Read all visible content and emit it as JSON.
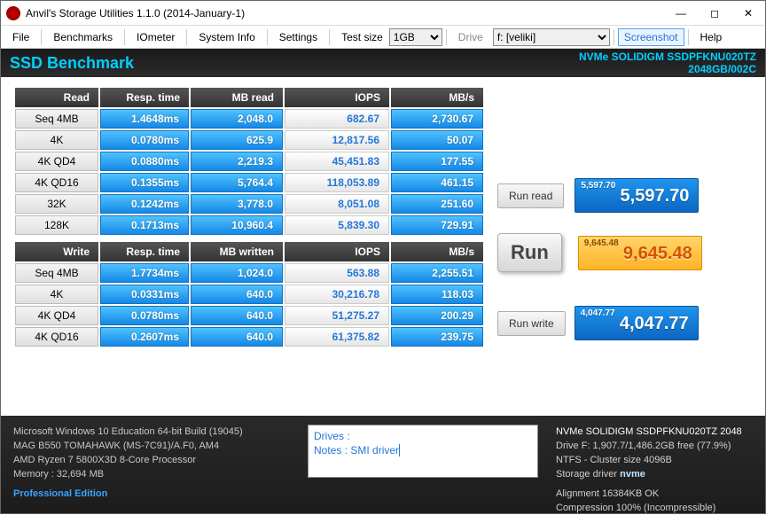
{
  "window": {
    "title": "Anvil's Storage Utilities 1.1.0 (2014-January-1)",
    "icon_letter": ""
  },
  "menu": {
    "file": "File",
    "benchmarks": "Benchmarks",
    "iometer": "IOmeter",
    "sysinfo": "System Info",
    "settings": "Settings",
    "test_size_label": "Test size",
    "test_size_selected": "1GB",
    "drive_label": "Drive",
    "drive_selected": "f: [veliki]",
    "screenshot": "Screenshot",
    "help": "Help"
  },
  "header": {
    "title": "SSD Benchmark",
    "device": "NVMe SOLIDIGM SSDPFKNU020TZ",
    "capacity": "2048GB/002C"
  },
  "read": {
    "headers": [
      "Read",
      "Resp. time",
      "MB read",
      "IOPS",
      "MB/s"
    ],
    "rows": [
      {
        "label": "Seq 4MB",
        "resp": "1.4648ms",
        "mb": "2,048.0",
        "iops": "682.67",
        "mbs": "2,730.67"
      },
      {
        "label": "4K",
        "resp": "0.0780ms",
        "mb": "625.9",
        "iops": "12,817.56",
        "mbs": "50.07"
      },
      {
        "label": "4K QD4",
        "resp": "0.0880ms",
        "mb": "2,219.3",
        "iops": "45,451.83",
        "mbs": "177.55"
      },
      {
        "label": "4K QD16",
        "resp": "0.1355ms",
        "mb": "5,764.4",
        "iops": "118,053.89",
        "mbs": "461.15"
      },
      {
        "label": "32K",
        "resp": "0.1242ms",
        "mb": "3,778.0",
        "iops": "8,051.08",
        "mbs": "251.60"
      },
      {
        "label": "128K",
        "resp": "0.1713ms",
        "mb": "10,960.4",
        "iops": "5,839.30",
        "mbs": "729.91"
      }
    ]
  },
  "write": {
    "headers": [
      "Write",
      "Resp. time",
      "MB written",
      "IOPS",
      "MB/s"
    ],
    "rows": [
      {
        "label": "Seq 4MB",
        "resp": "1.7734ms",
        "mb": "1,024.0",
        "iops": "563.88",
        "mbs": "2,255.51"
      },
      {
        "label": "4K",
        "resp": "0.0331ms",
        "mb": "640.0",
        "iops": "30,216.78",
        "mbs": "118.03"
      },
      {
        "label": "4K QD4",
        "resp": "0.0780ms",
        "mb": "640.0",
        "iops": "51,275.27",
        "mbs": "200.29"
      },
      {
        "label": "4K QD16",
        "resp": "0.2607ms",
        "mb": "640.0",
        "iops": "61,375.82",
        "mbs": "239.75"
      }
    ]
  },
  "buttons": {
    "run_read": "Run read",
    "run": "Run",
    "run_write": "Run write"
  },
  "scores": {
    "read_small": "5,597.70",
    "read_big": "5,597.70",
    "total_small": "9,645.48",
    "total_big": "9,645.48",
    "write_small": "4,047.77",
    "write_big": "4,047.77"
  },
  "sysinfo": {
    "l1": "Microsoft Windows 10 Education 64-bit Build (19045)",
    "l2": "MAG B550 TOMAHAWK (MS-7C91)/A.F0, AM4",
    "l3": "AMD Ryzen 7 5800X3D 8-Core Processor",
    "l4": "Memory : 32,694 MB",
    "edition": "Professional Edition"
  },
  "notes": {
    "line1": "Drives :",
    "line2": "Notes : SMI driver"
  },
  "driveinfo": {
    "l1": "NVMe SOLIDIGM SSDPFKNU020TZ 2048",
    "l2": "Drive F: 1,907.7/1,486.2GB free (77.9%)",
    "l3": "NTFS - Cluster size 4096B",
    "l4a": "Storage driver ",
    "l4b": "nvme",
    "l5": "Alignment 16384KB OK",
    "l6": "Compression 100% (Incompressible)"
  }
}
